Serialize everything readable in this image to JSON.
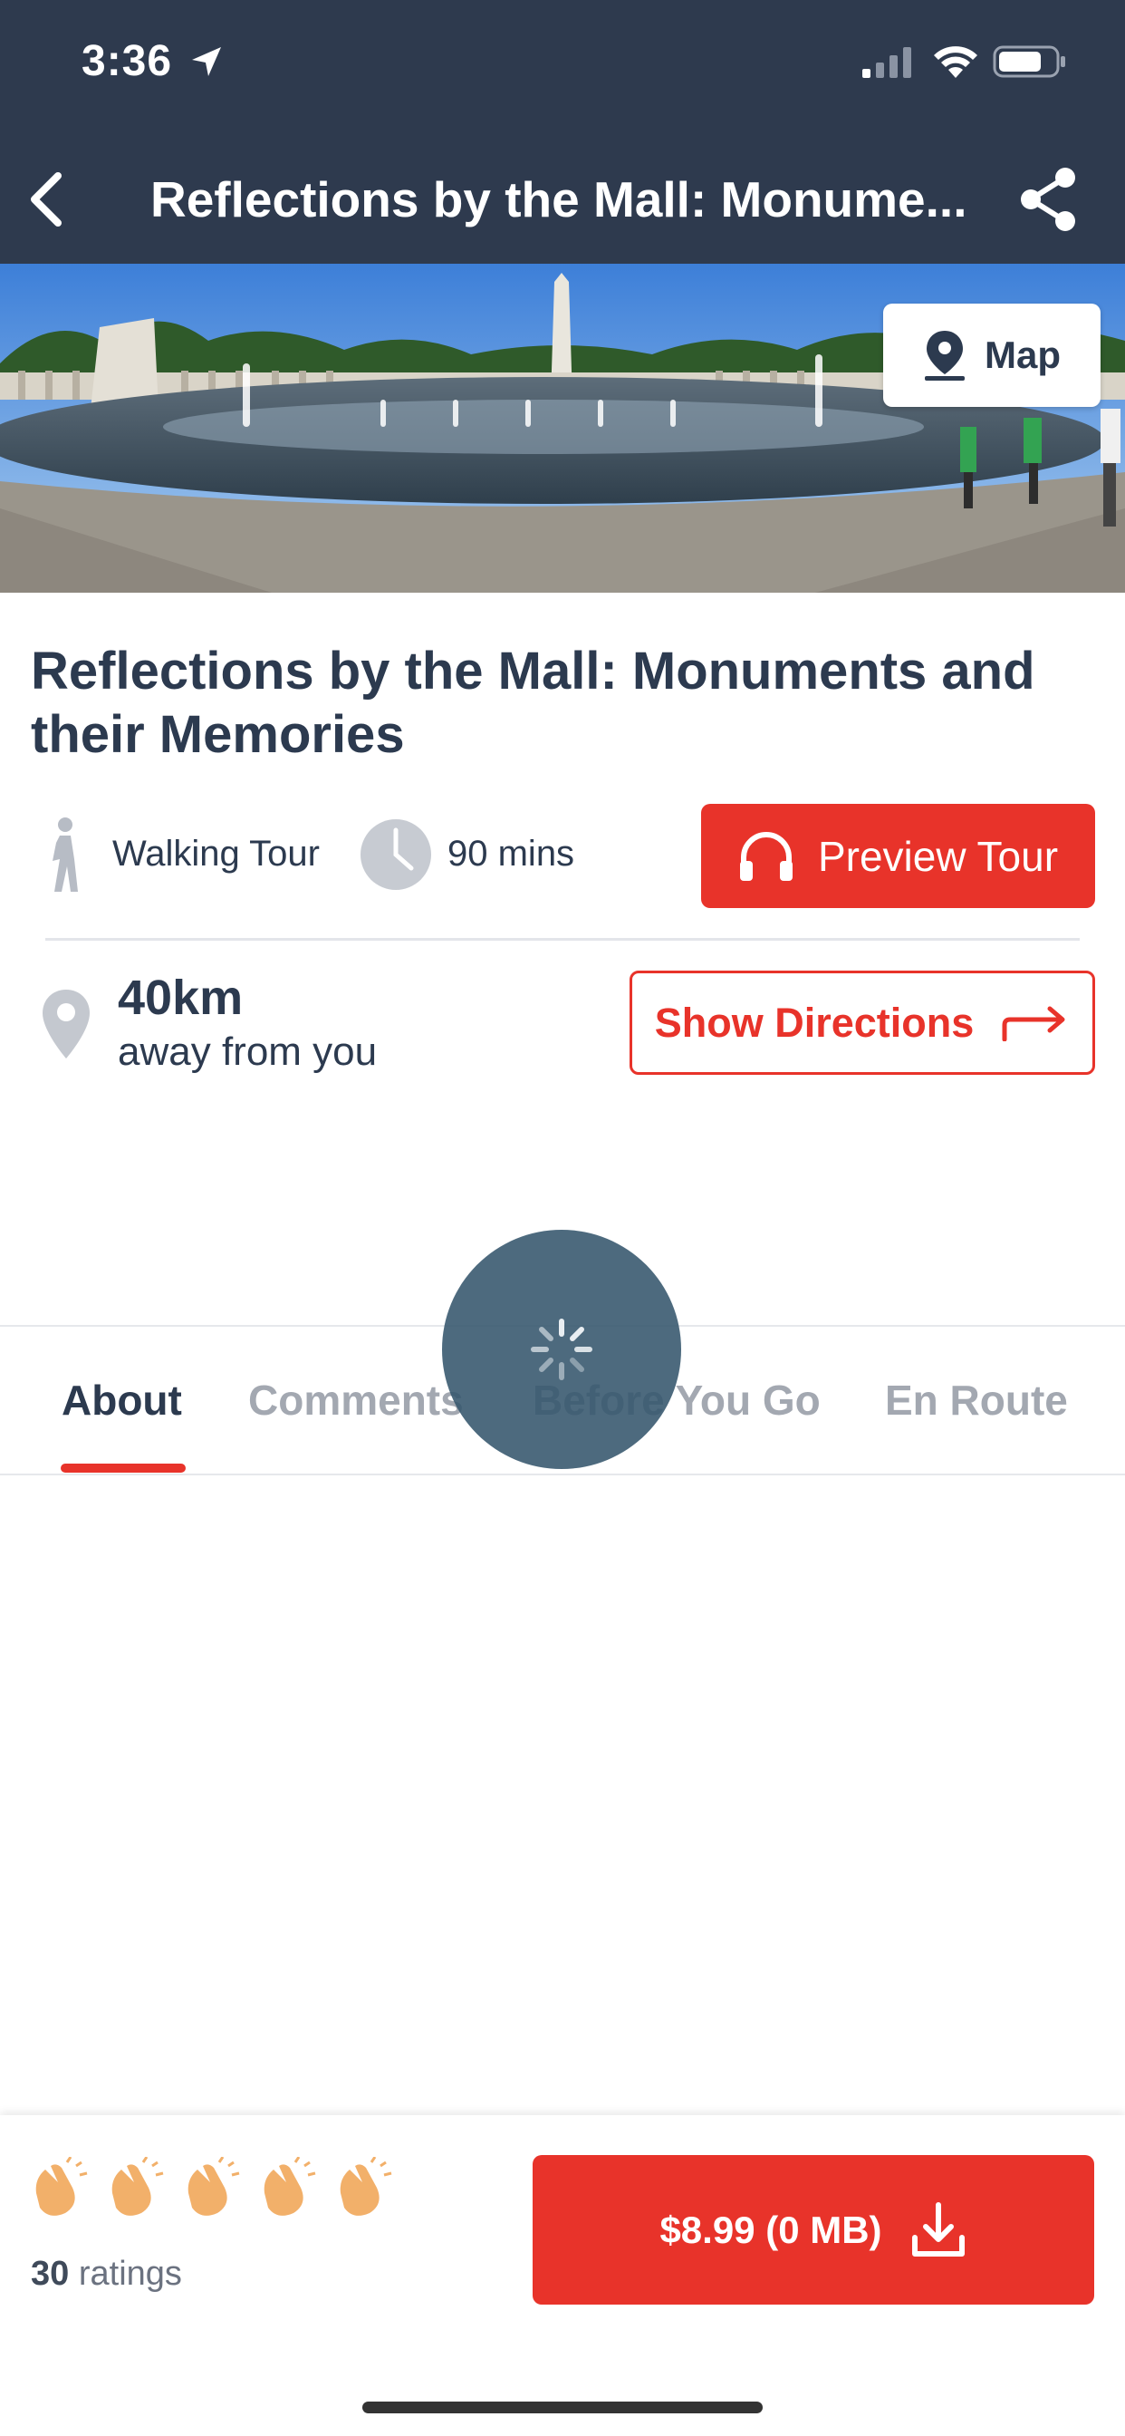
{
  "status_bar": {
    "time": "3:36"
  },
  "nav": {
    "title": "Reflections by the Mall: Monume..."
  },
  "hero": {
    "map_label": "Map"
  },
  "tour": {
    "title": "Reflections by the Mall: Monuments and their Memories",
    "type_label": "Walking Tour",
    "duration_label": "90 mins",
    "preview_label": "Preview Tour",
    "distance": "40km",
    "distance_sub": "away from you",
    "directions_label": "Show Directions"
  },
  "tabs": [
    {
      "label": "About",
      "active": true
    },
    {
      "label": "Comments",
      "active": false
    },
    {
      "label": "Before You Go",
      "active": false
    },
    {
      "label": "En Route",
      "active": false
    }
  ],
  "bottom": {
    "rating_icons": 5,
    "ratings_count": "30",
    "ratings_label": "ratings",
    "buy_label": "$8.99 (0 MB)"
  },
  "colors": {
    "navbar": "#2e3a4e",
    "accent": "#e8332a",
    "text": "#2c3a4f",
    "clap": "#f2b06a"
  }
}
